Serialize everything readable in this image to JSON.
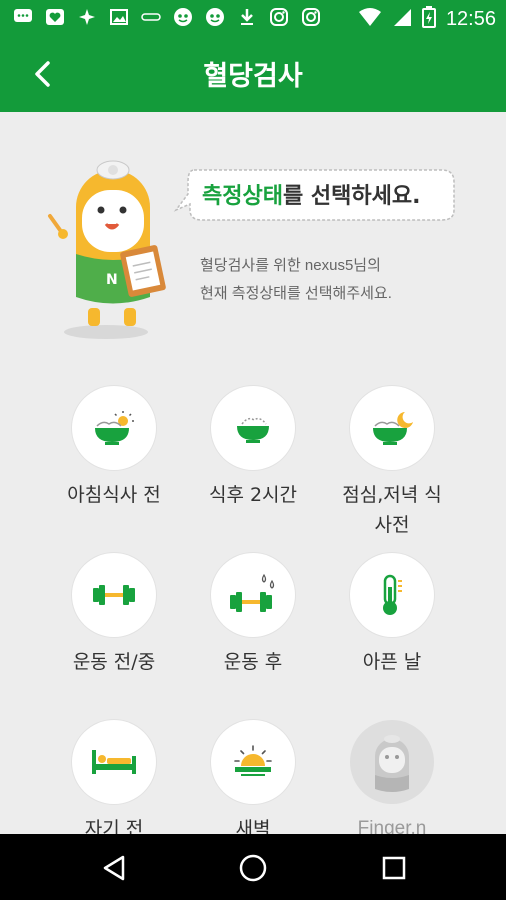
{
  "status_bar": {
    "time": "12:56",
    "left_icons": [
      "message-icon",
      "heart-icon",
      "sparkle-icon",
      "image-icon",
      "link-icon",
      "face-icon",
      "face-icon",
      "download-icon",
      "instagram-icon",
      "instagram-icon"
    ],
    "right_icons": [
      "wifi-icon",
      "signal-icon",
      "battery-charging-icon"
    ]
  },
  "app_bar": {
    "title": "혈당검사"
  },
  "intro": {
    "bubble_highlight": "측정상태",
    "bubble_rest": "를 선택하세요.",
    "description_line1": "혈당검사를 위한 nexus5님의",
    "description_line2": "현재 측정상태를 선택해주세요."
  },
  "options": [
    {
      "label": "아침식사 전",
      "icon": "bowl-sunrise-icon"
    },
    {
      "label": "식후 2시간",
      "icon": "bowl-icon"
    },
    {
      "label_line1": "점심,저녁 식",
      "label_line2": "사전",
      "icon": "bowl-moon-icon"
    },
    {
      "label": "운동 전/중",
      "icon": "dumbbell-icon"
    },
    {
      "label": "운동 후",
      "icon": "dumbbell-sweat-icon"
    },
    {
      "label": "아픈 날",
      "icon": "thermometer-icon"
    },
    {
      "label": "자기 전",
      "icon": "bed-icon"
    },
    {
      "label": "새벽",
      "icon": "dawn-sun-icon"
    },
    {
      "label": "Finger.n",
      "icon": "mascot-watermark-icon"
    }
  ],
  "colors": {
    "brand_green": "#139b3a",
    "icon_green": "#18a23e",
    "background": "#ededed"
  }
}
